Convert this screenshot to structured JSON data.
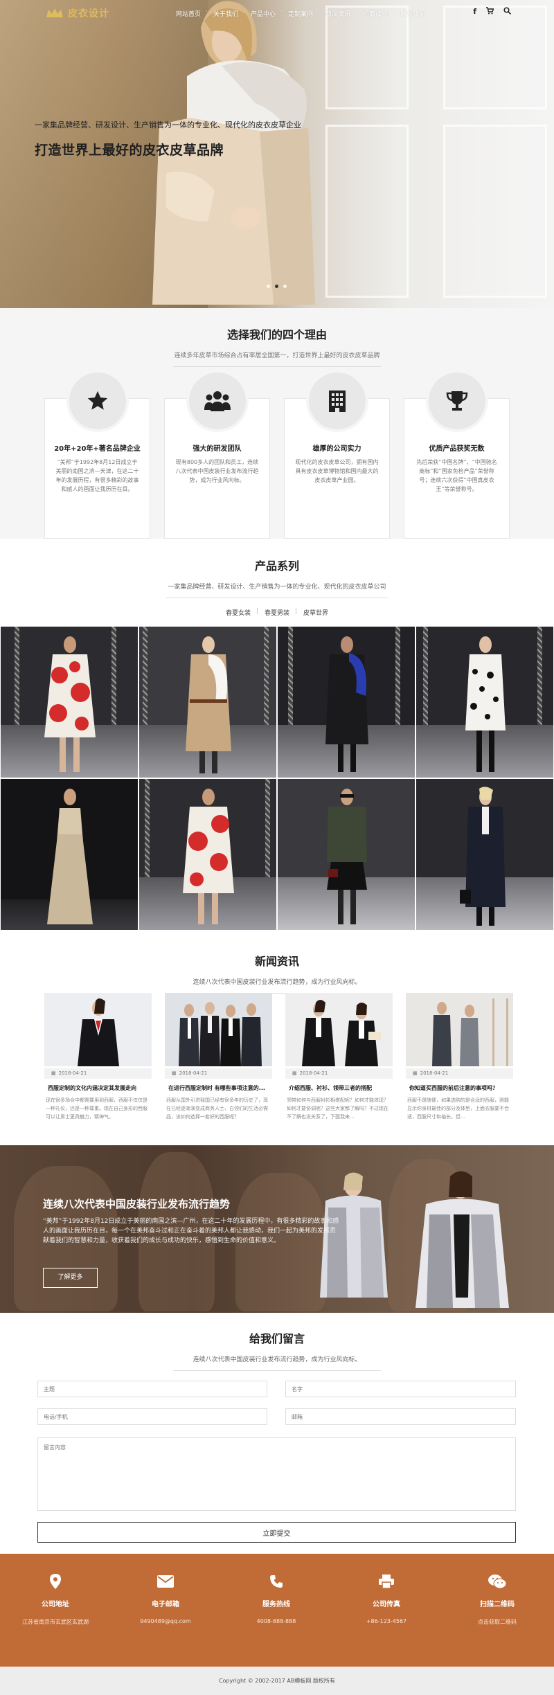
{
  "nav": {
    "logo_text": "皮衣设计",
    "menu": [
      "网站首页",
      "关于我们",
      "产品中心",
      "定制案例",
      "新闻资讯",
      "招商加盟",
      "联系我们"
    ],
    "icons": [
      "facebook-icon",
      "cart-icon",
      "search-icon"
    ]
  },
  "hero": {
    "subtitle": "一家集品牌经营、研发设计、生产销售为一体的专业化、现代化的皮衣皮草企业",
    "title": "打造世界上最好的皮衣皮草品牌",
    "slides": 3,
    "active_slide": 1
  },
  "reasons": {
    "title": "选择我们的四个理由",
    "subtitle": "连续多年皮草市场综合占有率居全国第一，打造世界上最好的皮衣皮草品牌",
    "cards": [
      {
        "icon": "star-icon",
        "title": "20年+20年+著名品牌企业",
        "text": "“美邦”于1992年8月12日成立于美丽的南国之滨—天津，在这二十年的发展历程，有很多精彩的故事和感人的画面让我历历在目。"
      },
      {
        "icon": "team-icon",
        "title": "强大的研发团队",
        "text": "现有800多人的团队和员工，连续八次代表中国皮装行业发布流行趋势，成为行业风向标。"
      },
      {
        "icon": "building-icon",
        "title": "雄厚的公司实力",
        "text": "现代化的皮衣皮草公司，拥有国内具有皮衣皮草博物馆和国内最大的皮衣皮草产业园。"
      },
      {
        "icon": "trophy-icon",
        "title": "优质产品获奖无数",
        "text": "先后荣获“中国名牌”、“中国驰名商标”和“国家免检产品”荣誉称号；连续六次获得“中国真皮衣王”等荣誉称号。"
      }
    ]
  },
  "products": {
    "title": "产品系列",
    "subtitle": "一家集品牌经营、研发设计、生产销售为一体的专业化、现代化的皮衣皮草公司",
    "tabs": [
      "春夏女装",
      "春夏男装",
      "皮草世界"
    ]
  },
  "news": {
    "title": "新闻资讯",
    "subtitle": "连续八次代表中国皮装行业发布流行趋势，成为行业风向标。",
    "items": [
      {
        "date": "2018-04-21",
        "headline": "西服定制的文化内涵决定其发展走向",
        "body": "现在很多场合中都需要用到西服，西服不仅仅是一种礼仪，还是一种尊重。现在自己身形的西服可以让男士更具魅力，精神气。"
      },
      {
        "date": "2018-04-21",
        "headline": "在进行西服定制时 有哪些事项注意的...",
        "body": "西服从国外引进我国已经有很多年的历史了，现在已经逐渐演变成商务人士、白领们的生活必需品，该如何选择一套好的西服呢？"
      },
      {
        "date": "2018-04-21",
        "headline": "介绍西服、衬衫、领带三者的搭配",
        "body": "领带如何与西服衬衫相搭配呢？如何才能体现？如何才要协调呢？这些大家都了解吗？不过现在不了解也没关系了，下面我来..."
      },
      {
        "date": "2018-04-21",
        "headline": "你知道买西服的前后注意的事项吗？",
        "body": "西服不是随便，如果选购的是合适的西服，则能显示你身材最佳的部分及体型，上面衣服要不合适，西服尺寸和袖长，但..."
      }
    ]
  },
  "banner": {
    "title": "连续八次代表中国皮装行业发布流行趋势",
    "text": "“美邦”于1992年8月12日成立于美丽的南国之滨—广州，在这二十年的发展历程中，有很多精彩的故事和感人的画面让我历历在目，每一个在美邦奋斗过和正在奋斗着的美邦人都让我感动，我们一起为美邦的发展贡献着我们的智慧和力量，收获着我们的成长与成功的快乐，感悟到生命的价值和意义。",
    "button": "了解更多"
  },
  "message": {
    "title": "给我们留言",
    "subtitle": "连续八次代表中国皮装行业发布流行趋势，成为行业风向标。",
    "fields": {
      "subject": "主题",
      "name": "名字",
      "phone": "电话/手机",
      "email": "邮箱",
      "content": "留言内容"
    },
    "submit": "立即提交"
  },
  "footer": {
    "columns": [
      {
        "icon": "location-icon",
        "title": "公司地址",
        "value": "江苏省南京市玄武区玄武湖"
      },
      {
        "icon": "mail-icon",
        "title": "电子邮箱",
        "value": "9490489@qq.com"
      },
      {
        "icon": "phone-icon",
        "title": "服务热线",
        "value": "4008-888-888"
      },
      {
        "icon": "printer-icon",
        "title": "公司传真",
        "value": "+86-123-4567"
      },
      {
        "icon": "wechat-icon",
        "title": "扫描二维码",
        "value": "点击获取二维码"
      }
    ],
    "copyright": "Copyright © 2002-2017 AB模板网 版权所有"
  },
  "colors": {
    "accent": "#c16c37",
    "text": "#333333",
    "muted": "#777777",
    "section_bg": "#f5f5f5"
  }
}
